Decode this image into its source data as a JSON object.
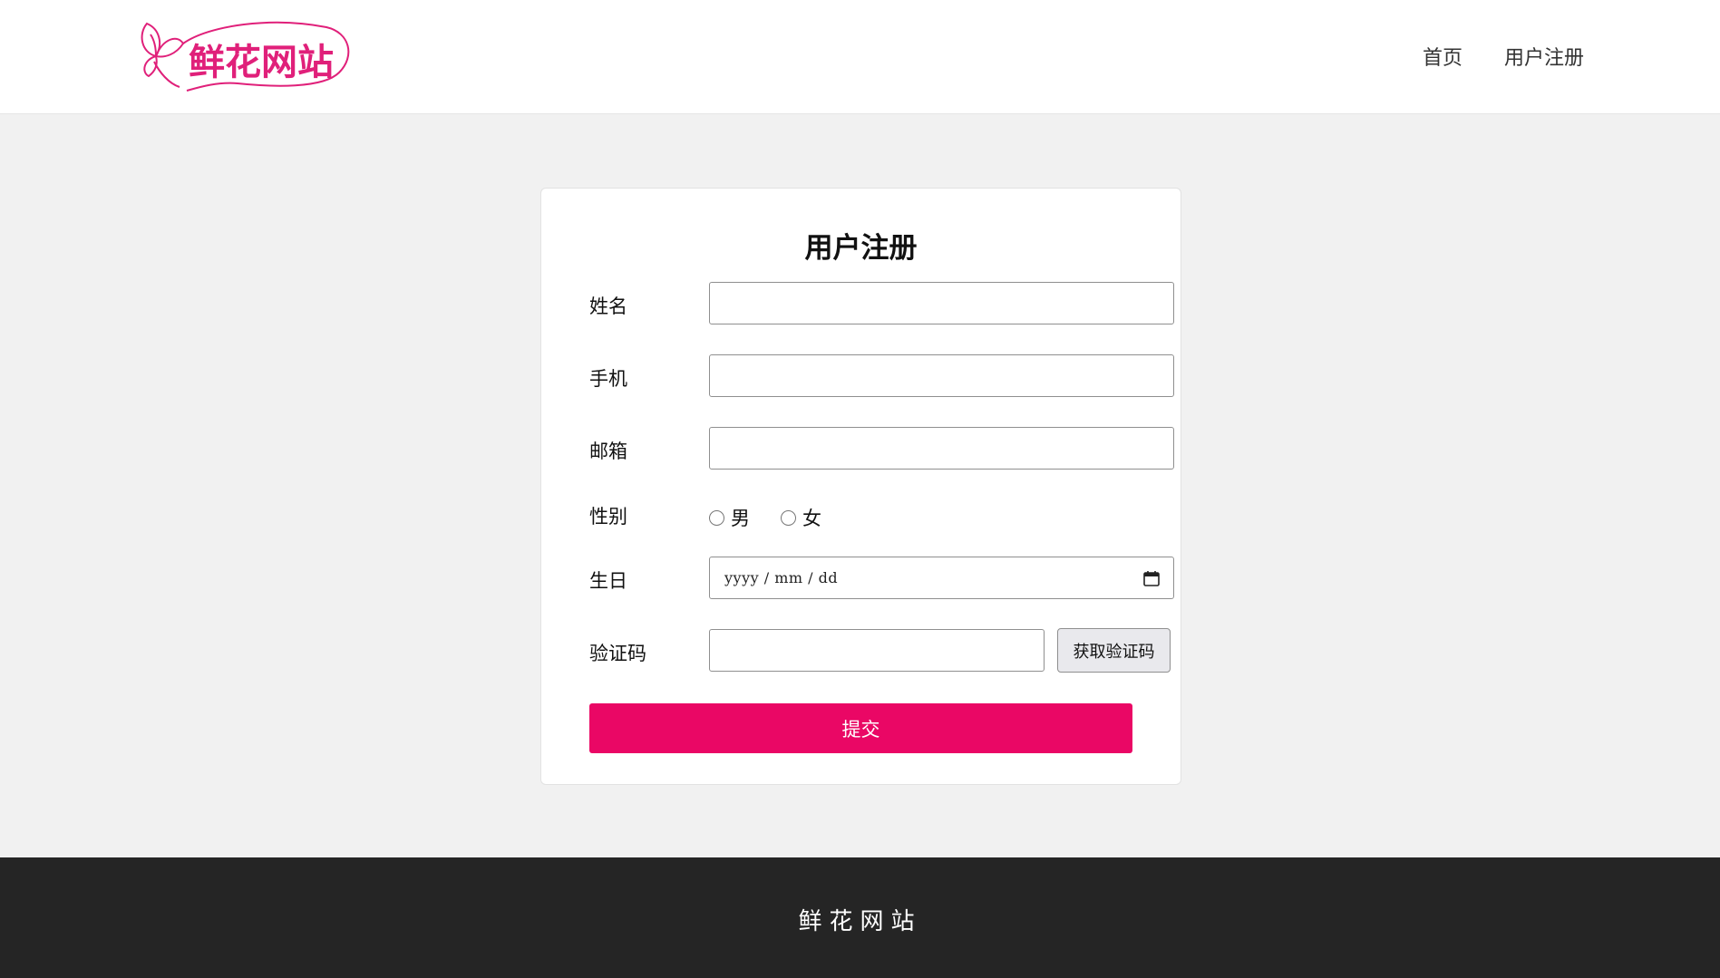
{
  "header": {
    "logo_text": "鲜花网站",
    "nav": [
      {
        "label": "首页"
      },
      {
        "label": "用户注册"
      }
    ]
  },
  "form": {
    "title": "用户注册",
    "fields": {
      "name_label": "姓名",
      "phone_label": "手机",
      "email_label": "邮箱",
      "gender_label": "性别",
      "gender_options": [
        "男",
        "女"
      ],
      "birthday_label": "生日",
      "birthday_placeholder": "yyyy / mm / dd",
      "code_label": "验证码"
    },
    "get_code_button": "获取验证码",
    "submit_button": "提交"
  },
  "footer": {
    "text": "鲜花网站"
  },
  "colors": {
    "brand": "#ea0765",
    "footer_bg": "#252525",
    "page_bg": "#f1f1f1"
  }
}
